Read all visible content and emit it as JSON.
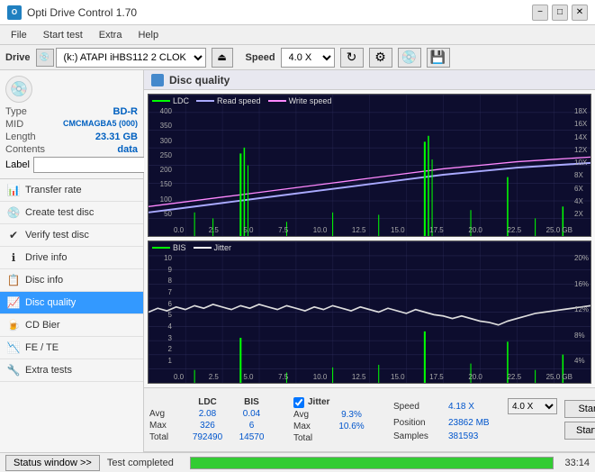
{
  "titlebar": {
    "title": "Opti Drive Control 1.70",
    "min_label": "−",
    "max_label": "□",
    "close_label": "✕"
  },
  "menubar": {
    "items": [
      "File",
      "Start test",
      "Extra",
      "Help"
    ]
  },
  "drivebar": {
    "drive_label": "Drive",
    "drive_value": "(k:) ATAPI iHBS112  2 CLOK",
    "speed_label": "Speed",
    "speed_value": "4.0 X"
  },
  "disc": {
    "type_label": "Type",
    "type_value": "BD-R",
    "mid_label": "MID",
    "mid_value": "CMCMAGBA5 (000)",
    "length_label": "Length",
    "length_value": "23.31 GB",
    "contents_label": "Contents",
    "contents_value": "data",
    "label_label": "Label",
    "label_value": ""
  },
  "sidebar": {
    "items": [
      {
        "id": "transfer-rate",
        "label": "Transfer rate",
        "icon": "📊"
      },
      {
        "id": "create-test-disc",
        "label": "Create test disc",
        "icon": "💿"
      },
      {
        "id": "verify-test-disc",
        "label": "Verify test disc",
        "icon": "✔"
      },
      {
        "id": "drive-info",
        "label": "Drive info",
        "icon": "ℹ"
      },
      {
        "id": "disc-info",
        "label": "Disc info",
        "icon": "📋"
      },
      {
        "id": "disc-quality",
        "label": "Disc quality",
        "icon": "📈",
        "active": true
      },
      {
        "id": "cd-bier",
        "label": "CD Bier",
        "icon": "🍺"
      },
      {
        "id": "fe-te",
        "label": "FE / TE",
        "icon": "📉"
      },
      {
        "id": "extra-tests",
        "label": "Extra tests",
        "icon": "🔧"
      }
    ]
  },
  "disc_quality": {
    "title": "Disc quality",
    "top_chart": {
      "legend": [
        {
          "label": "LDC",
          "color": "#00ff00"
        },
        {
          "label": "Read speed",
          "color": "#aaaaff"
        },
        {
          "label": "Write speed",
          "color": "#ff88ff"
        }
      ],
      "y_left": [
        "400",
        "350",
        "300",
        "250",
        "200",
        "150",
        "100",
        "50"
      ],
      "y_right": [
        "18X",
        "16X",
        "14X",
        "12X",
        "10X",
        "8X",
        "6X",
        "4X",
        "2X"
      ],
      "x_labels": [
        "0.0",
        "2.5",
        "5.0",
        "7.5",
        "10.0",
        "12.5",
        "15.0",
        "17.5",
        "20.0",
        "22.5",
        "25.0 GB"
      ]
    },
    "bottom_chart": {
      "legend": [
        {
          "label": "BIS",
          "color": "#00ff00"
        },
        {
          "label": "Jitter",
          "color": "#ffffff"
        }
      ],
      "y_left": [
        "10",
        "9",
        "8",
        "7",
        "6",
        "5",
        "4",
        "3",
        "2",
        "1"
      ],
      "y_right": [
        "20%",
        "16%",
        "12%",
        "8%",
        "4%"
      ],
      "x_labels": [
        "0.0",
        "2.5",
        "5.0",
        "7.5",
        "10.0",
        "12.5",
        "15.0",
        "17.5",
        "20.0",
        "22.5",
        "25.0 GB"
      ]
    }
  },
  "stats": {
    "columns": [
      "LDC",
      "BIS",
      "Jitter",
      "Speed",
      ""
    ],
    "avg_label": "Avg",
    "max_label": "Max",
    "total_label": "Total",
    "ldc_avg": "2.08",
    "ldc_max": "326",
    "ldc_total": "792490",
    "bis_avg": "0.04",
    "bis_max": "6",
    "bis_total": "14570",
    "jitter_avg": "9.3%",
    "jitter_max": "10.6%",
    "jitter_total": "",
    "jitter_checked": true,
    "speed_label": "Speed",
    "speed_value": "4.18 X",
    "speed_select": "4.0 X",
    "position_label": "Position",
    "position_value": "23862 MB",
    "samples_label": "Samples",
    "samples_value": "381593",
    "start_full_label": "Start full",
    "start_part_label": "Start part"
  },
  "statusbar": {
    "window_btn": "Status window >>",
    "status_text": "Test completed",
    "progress": 100,
    "time": "33:14"
  }
}
